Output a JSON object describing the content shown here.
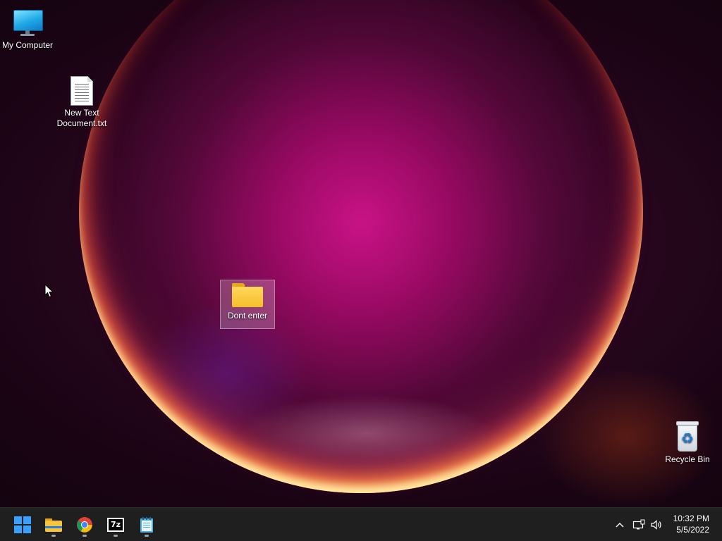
{
  "desktop": {
    "icons": [
      {
        "label": "My Computer",
        "icon": "monitor-icon"
      },
      {
        "label": "New Text Document.txt",
        "icon": "text-document-icon"
      },
      {
        "label": "Dont enter",
        "icon": "folder-icon",
        "selected": true
      },
      {
        "label": "Recycle Bin",
        "icon": "recycle-bin-icon"
      }
    ],
    "recycle_symbol": "♻"
  },
  "taskbar": {
    "pinned": [
      {
        "name": "start",
        "icon": "windows-logo-icon",
        "running": false
      },
      {
        "name": "file-explorer",
        "icon": "folder-icon",
        "running": true
      },
      {
        "name": "chrome",
        "icon": "chrome-icon",
        "running": true
      },
      {
        "name": "7-zip",
        "icon": "7zip-icon",
        "label": "7z",
        "running": true
      },
      {
        "name": "notepad",
        "icon": "notepad-icon",
        "running": true
      }
    ],
    "tray": {
      "show_hidden_icon": "chevron-up-icon",
      "network_icon": "network-icon",
      "volume_icon": "volume-icon",
      "time": "10:32 PM",
      "date": "5/5/2022",
      "chevron": "^"
    }
  },
  "colors": {
    "taskbar_bg": "#1f1f1f",
    "accent": "#3aa0ff",
    "folder": "#f5bd2c"
  }
}
